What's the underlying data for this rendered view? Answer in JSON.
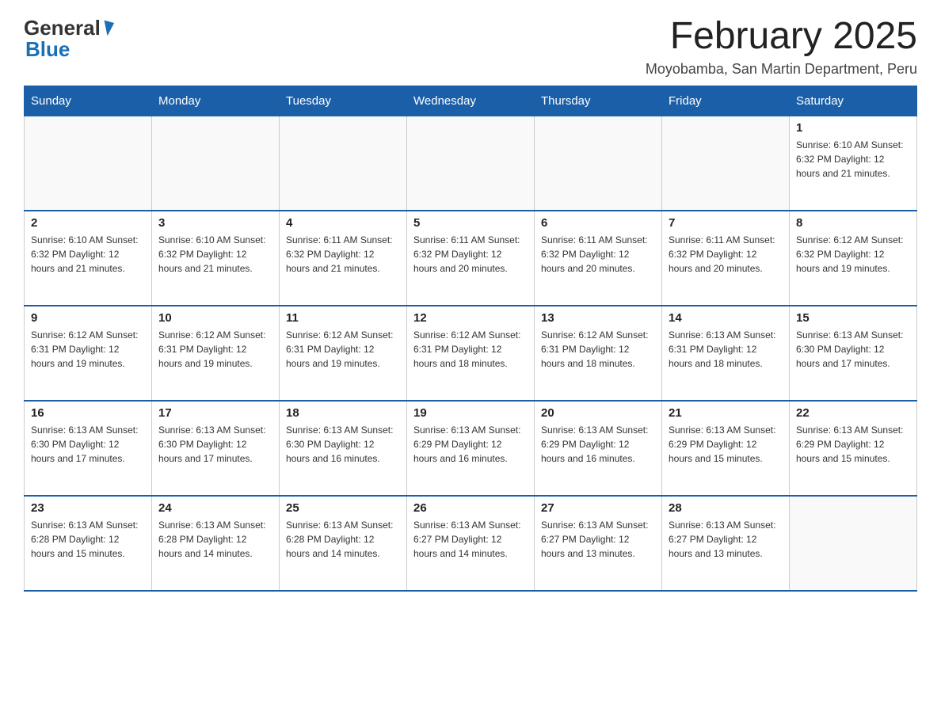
{
  "header": {
    "logo_general": "General",
    "logo_blue": "Blue",
    "title": "February 2025",
    "subtitle": "Moyobamba, San Martin Department, Peru"
  },
  "days_of_week": [
    "Sunday",
    "Monday",
    "Tuesday",
    "Wednesday",
    "Thursday",
    "Friday",
    "Saturday"
  ],
  "weeks": [
    [
      {
        "day": "",
        "info": ""
      },
      {
        "day": "",
        "info": ""
      },
      {
        "day": "",
        "info": ""
      },
      {
        "day": "",
        "info": ""
      },
      {
        "day": "",
        "info": ""
      },
      {
        "day": "",
        "info": ""
      },
      {
        "day": "1",
        "info": "Sunrise: 6:10 AM\nSunset: 6:32 PM\nDaylight: 12 hours and 21 minutes."
      }
    ],
    [
      {
        "day": "2",
        "info": "Sunrise: 6:10 AM\nSunset: 6:32 PM\nDaylight: 12 hours and 21 minutes."
      },
      {
        "day": "3",
        "info": "Sunrise: 6:10 AM\nSunset: 6:32 PM\nDaylight: 12 hours and 21 minutes."
      },
      {
        "day": "4",
        "info": "Sunrise: 6:11 AM\nSunset: 6:32 PM\nDaylight: 12 hours and 21 minutes."
      },
      {
        "day": "5",
        "info": "Sunrise: 6:11 AM\nSunset: 6:32 PM\nDaylight: 12 hours and 20 minutes."
      },
      {
        "day": "6",
        "info": "Sunrise: 6:11 AM\nSunset: 6:32 PM\nDaylight: 12 hours and 20 minutes."
      },
      {
        "day": "7",
        "info": "Sunrise: 6:11 AM\nSunset: 6:32 PM\nDaylight: 12 hours and 20 minutes."
      },
      {
        "day": "8",
        "info": "Sunrise: 6:12 AM\nSunset: 6:32 PM\nDaylight: 12 hours and 19 minutes."
      }
    ],
    [
      {
        "day": "9",
        "info": "Sunrise: 6:12 AM\nSunset: 6:31 PM\nDaylight: 12 hours and 19 minutes."
      },
      {
        "day": "10",
        "info": "Sunrise: 6:12 AM\nSunset: 6:31 PM\nDaylight: 12 hours and 19 minutes."
      },
      {
        "day": "11",
        "info": "Sunrise: 6:12 AM\nSunset: 6:31 PM\nDaylight: 12 hours and 19 minutes."
      },
      {
        "day": "12",
        "info": "Sunrise: 6:12 AM\nSunset: 6:31 PM\nDaylight: 12 hours and 18 minutes."
      },
      {
        "day": "13",
        "info": "Sunrise: 6:12 AM\nSunset: 6:31 PM\nDaylight: 12 hours and 18 minutes."
      },
      {
        "day": "14",
        "info": "Sunrise: 6:13 AM\nSunset: 6:31 PM\nDaylight: 12 hours and 18 minutes."
      },
      {
        "day": "15",
        "info": "Sunrise: 6:13 AM\nSunset: 6:30 PM\nDaylight: 12 hours and 17 minutes."
      }
    ],
    [
      {
        "day": "16",
        "info": "Sunrise: 6:13 AM\nSunset: 6:30 PM\nDaylight: 12 hours and 17 minutes."
      },
      {
        "day": "17",
        "info": "Sunrise: 6:13 AM\nSunset: 6:30 PM\nDaylight: 12 hours and 17 minutes."
      },
      {
        "day": "18",
        "info": "Sunrise: 6:13 AM\nSunset: 6:30 PM\nDaylight: 12 hours and 16 minutes."
      },
      {
        "day": "19",
        "info": "Sunrise: 6:13 AM\nSunset: 6:29 PM\nDaylight: 12 hours and 16 minutes."
      },
      {
        "day": "20",
        "info": "Sunrise: 6:13 AM\nSunset: 6:29 PM\nDaylight: 12 hours and 16 minutes."
      },
      {
        "day": "21",
        "info": "Sunrise: 6:13 AM\nSunset: 6:29 PM\nDaylight: 12 hours and 15 minutes."
      },
      {
        "day": "22",
        "info": "Sunrise: 6:13 AM\nSunset: 6:29 PM\nDaylight: 12 hours and 15 minutes."
      }
    ],
    [
      {
        "day": "23",
        "info": "Sunrise: 6:13 AM\nSunset: 6:28 PM\nDaylight: 12 hours and 15 minutes."
      },
      {
        "day": "24",
        "info": "Sunrise: 6:13 AM\nSunset: 6:28 PM\nDaylight: 12 hours and 14 minutes."
      },
      {
        "day": "25",
        "info": "Sunrise: 6:13 AM\nSunset: 6:28 PM\nDaylight: 12 hours and 14 minutes."
      },
      {
        "day": "26",
        "info": "Sunrise: 6:13 AM\nSunset: 6:27 PM\nDaylight: 12 hours and 14 minutes."
      },
      {
        "day": "27",
        "info": "Sunrise: 6:13 AM\nSunset: 6:27 PM\nDaylight: 12 hours and 13 minutes."
      },
      {
        "day": "28",
        "info": "Sunrise: 6:13 AM\nSunset: 6:27 PM\nDaylight: 12 hours and 13 minutes."
      },
      {
        "day": "",
        "info": ""
      }
    ]
  ]
}
